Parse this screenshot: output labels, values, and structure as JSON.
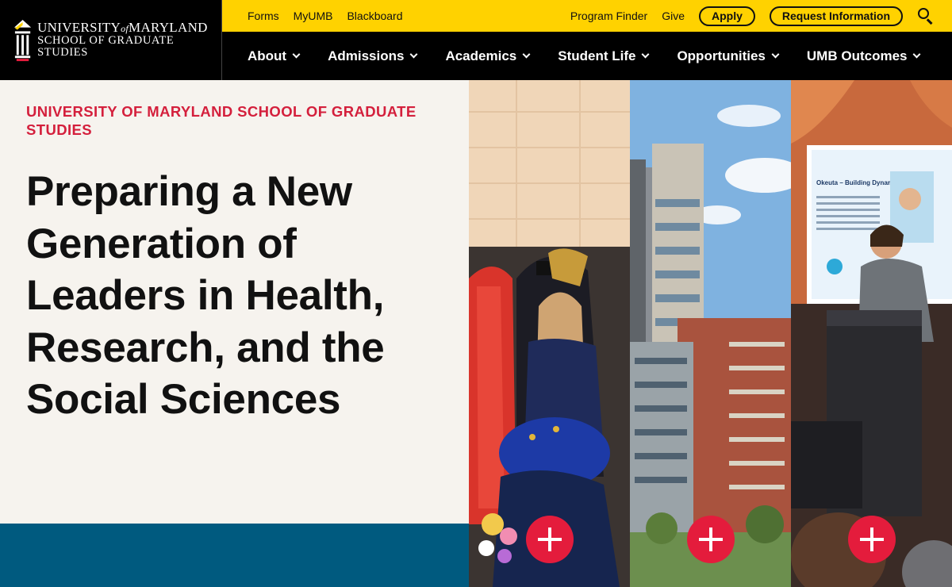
{
  "brand": {
    "line1_a": "University",
    "line1_of": "of",
    "line1_b": "Maryland",
    "line2": "School of Graduate Studies"
  },
  "utility": {
    "left_links": [
      "Forms",
      "MyUMB",
      "Blackboard"
    ],
    "right_links": [
      "Program Finder",
      "Give"
    ],
    "apply_label": "Apply",
    "request_label": "Request Information"
  },
  "nav": {
    "items": [
      "About",
      "Admissions",
      "Academics",
      "Student Life",
      "Opportunities",
      "UMB Outcomes"
    ]
  },
  "hero": {
    "eyebrow": "University of Maryland School of Graduate Studies",
    "headline": "Preparing a New Generation of Leaders in Health, Research, and the Social Sciences"
  },
  "panels": {
    "slide_text_title": "Okeuta – Building Dynamic Cities"
  },
  "colors": {
    "gold": "#ffd200",
    "red": "#e41c3c",
    "eyebrow_red": "#d41f3c",
    "blue_band": "#005a7f",
    "cream": "#f6f3ee"
  },
  "icons": [
    "umb-logo-icon",
    "search-icon",
    "chevron-down-icon",
    "plus-icon"
  ]
}
